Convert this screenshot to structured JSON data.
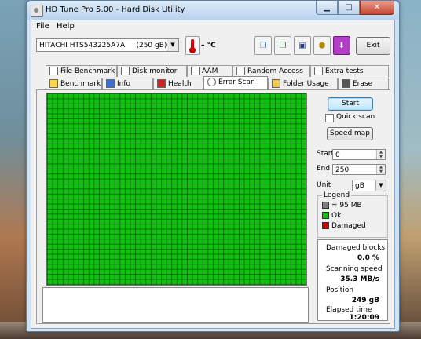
{
  "window": {
    "title": "HD Tune Pro 5.00 - Hard Disk Utility"
  },
  "menu": {
    "file": "File",
    "help": "Help"
  },
  "toolbar": {
    "drive": "HITACHI HTS543225A7A     (250 gB)",
    "temperature": "– °C",
    "exit_label": "Exit"
  },
  "tabs_top": [
    {
      "label": "File Benchmark",
      "icon": "chart-icon"
    },
    {
      "label": "Disk monitor",
      "icon": "monitor-icon"
    },
    {
      "label": "AAM",
      "icon": "speaker-icon"
    },
    {
      "label": "Random Access",
      "icon": "random-icon"
    },
    {
      "label": "Extra tests",
      "icon": "tests-icon"
    }
  ],
  "tabs_bottom": [
    {
      "label": "Benchmark",
      "icon": "bulb-icon"
    },
    {
      "label": "Info",
      "icon": "info-icon"
    },
    {
      "label": "Health",
      "icon": "health-icon"
    },
    {
      "label": "Error Scan",
      "icon": "magnifier-icon",
      "active": true
    },
    {
      "label": "Folder Usage",
      "icon": "folder-icon"
    },
    {
      "label": "Erase",
      "icon": "trash-icon"
    }
  ],
  "scan": {
    "start_label": "Start",
    "quick_scan_label": "Quick scan",
    "quick_scan_checked": false,
    "speed_map_label": "Speed map",
    "start_field_label": "Start",
    "start_value": "0",
    "end_field_label": "End",
    "end_value": "250",
    "unit_label": "Unit",
    "unit_value": "gB"
  },
  "legend": {
    "title": "Legend",
    "items": [
      {
        "label": "= 95 MB",
        "color": "#808080"
      },
      {
        "label": "Ok",
        "color": "#11c011"
      },
      {
        "label": "Damaged",
        "color": "#cc0000"
      }
    ]
  },
  "stats": {
    "damaged_label": "Damaged blocks",
    "damaged_value": "0.0 %",
    "speed_label": "Scanning speed",
    "speed_value": "35.3 MB/s",
    "position_label": "Position",
    "position_value": "249 gB",
    "elapsed_label": "Elapsed time",
    "elapsed_value": "1:20:09"
  },
  "colors": {
    "ok_block": "#11c011",
    "accent": "#3c7fb1"
  }
}
